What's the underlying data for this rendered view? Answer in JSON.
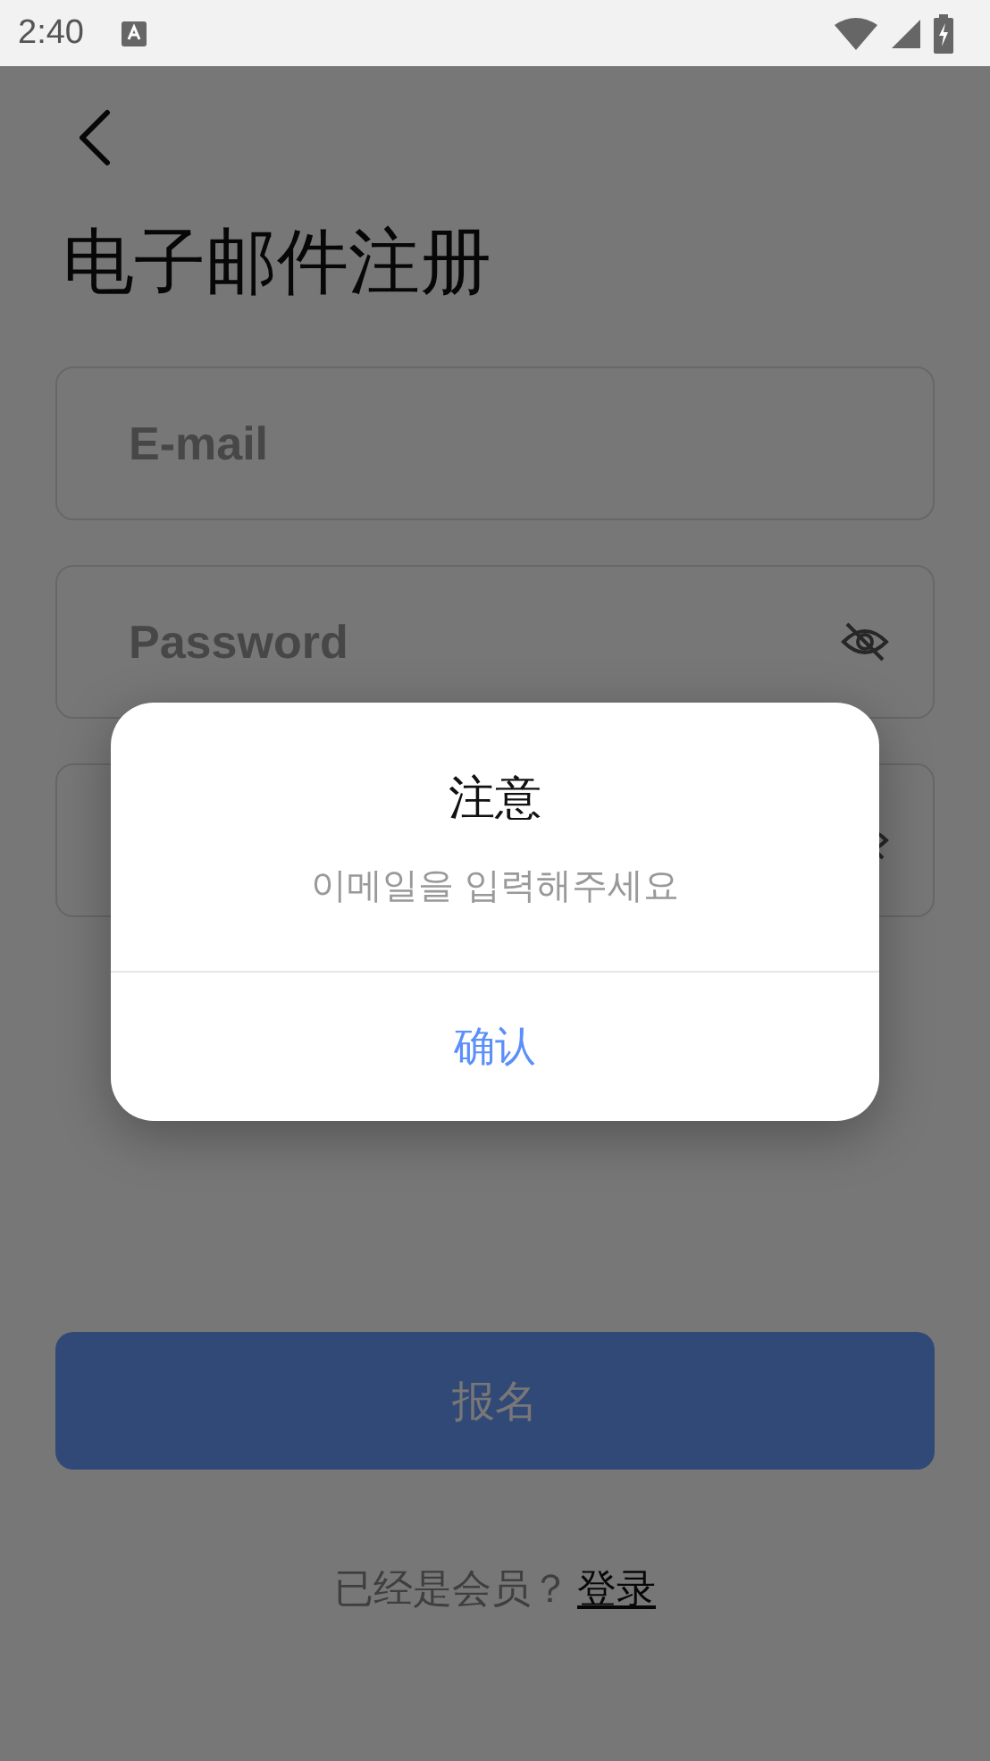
{
  "status_bar": {
    "time": "2:40"
  },
  "title": "电子邮件注册",
  "fields": [
    {
      "placeholder": "E-mail",
      "password_toggle": false
    },
    {
      "placeholder": "Password",
      "password_toggle": true
    },
    {
      "password_toggle": true
    }
  ],
  "submit_button": "报名",
  "footer": {
    "text": "已经是会员？",
    "link": "登录"
  },
  "dialog": {
    "title": "注意",
    "message": "이메일을 입력해주세요",
    "button": "确认"
  }
}
